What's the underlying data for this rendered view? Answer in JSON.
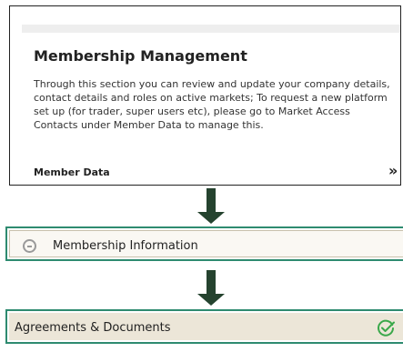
{
  "membership_card": {
    "title": "Membership Management",
    "description": "Through this section you can review and update your company details, contact details and roles on active markets; To request a new platform set up (for trader, super users etc), please go to Market Access Contacts under Member Data to manage this.",
    "link_label": "Member Data",
    "link_chevron": "»"
  },
  "steps": [
    {
      "label": "Membership Information",
      "icon": "minus-circle-icon",
      "status": "expanded"
    },
    {
      "label": "Agreements & Documents",
      "icon": "check-circle-icon",
      "status": "complete"
    }
  ],
  "colors": {
    "arrow": "#25432f",
    "step_border": "#2e8b70",
    "check": "#3aa84a",
    "agreements_bg": "#ece6d8"
  }
}
